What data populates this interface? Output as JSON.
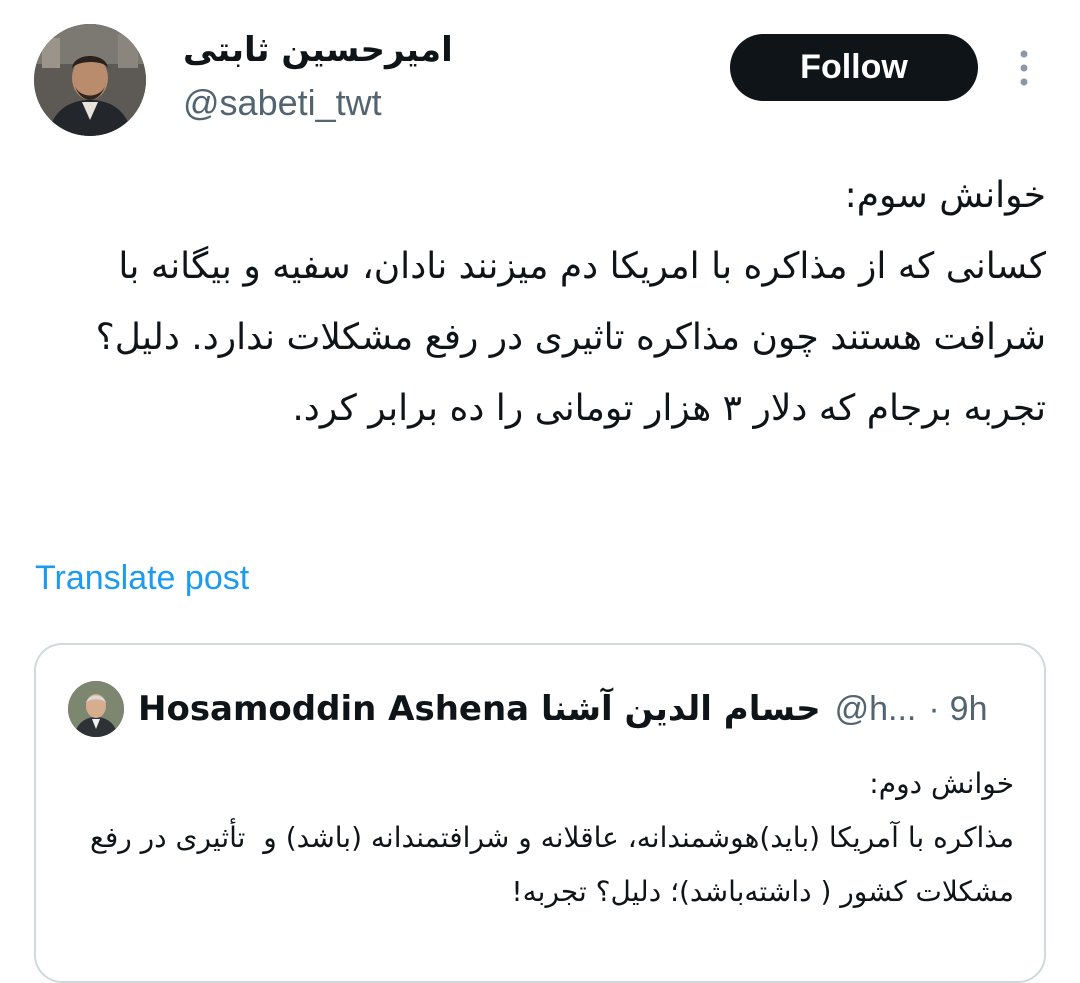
{
  "author": {
    "display_name": "امیرحسین ثابتی",
    "handle": "@sabeti_twt",
    "avatar_icon": "user-avatar-photo"
  },
  "follow_label": "Follow",
  "more_icon": "vertical-ellipsis-icon",
  "post": {
    "text": "خوانش سوم:\nکسانی که از مذاکره با امریکا دم میزنند نادان، سفیه و بیگانه با شرافت هستند چون مذاکره تاثیری در رفع مشکلات ندارد. دلیل؟ تجربه برجام که دلار ۳ هزار تومانی را ده برابر کرد."
  },
  "translate_label": "Translate post",
  "quoted_post": {
    "name": "Hosamoddin Ashena حسام الدین آشنا",
    "handle": "@h...",
    "separator": "·",
    "time": "9h",
    "text": "خوانش دوم:\nمذاکره با آمریکا (باید)هوشمندانه، عاقلانه و شرافتمندانه (باشد) و  تأثیری در رفع مشکلات کشور ( داشته‌باشد)؛ دلیل؟ تجربه!"
  },
  "colors": {
    "text": "#0f1419",
    "secondary": "#536471",
    "link": "#1d9bf0",
    "button": "#0f1419",
    "border": "#cfd9de"
  }
}
